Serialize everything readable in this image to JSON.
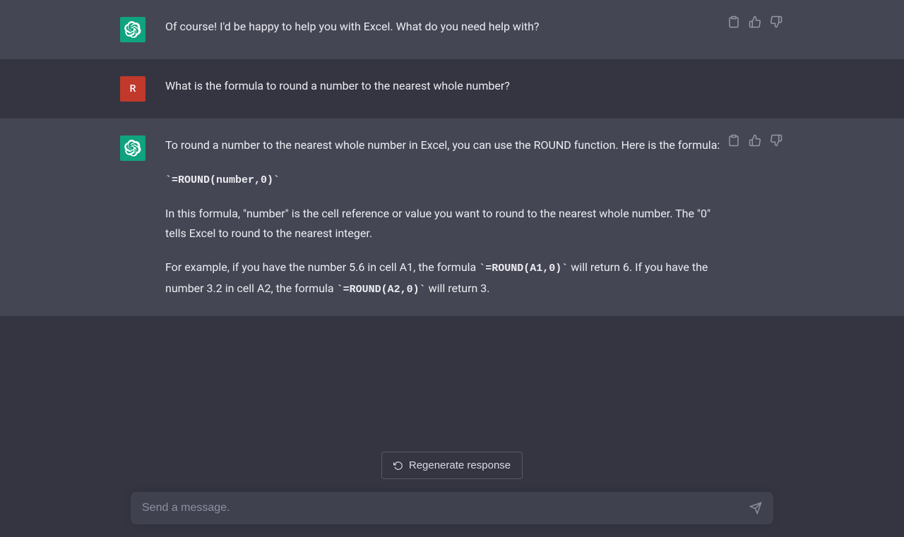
{
  "user_initial": "R",
  "conversation": {
    "m1_text": "Of course! I'd be happy to help you with Excel. What do you need help with?",
    "m2_text": "What is the formula to round a number to the nearest whole number?",
    "m3_p1": "To round a number to the nearest whole number in Excel, you can use the ROUND function. Here is the formula:",
    "m3_code_block": "`=ROUND(number,0)`",
    "m3_p2": "In this formula, \"number\" is the cell reference or value you want to round to the nearest whole number. The \"0\" tells Excel to round to the nearest integer.",
    "m3_p3_a": "For example, if you have the number 5.6 in cell A1, the formula ",
    "m3_p3_code1": "`=ROUND(A1,0)`",
    "m3_p3_b": " will return 6. If you have the number 3.2 in cell A2, the formula ",
    "m3_p3_code2": "`=ROUND(A2,0)`",
    "m3_p3_c": " will return 3."
  },
  "footer": {
    "regen_label": "Regenerate response",
    "input_placeholder": "Send a message."
  }
}
